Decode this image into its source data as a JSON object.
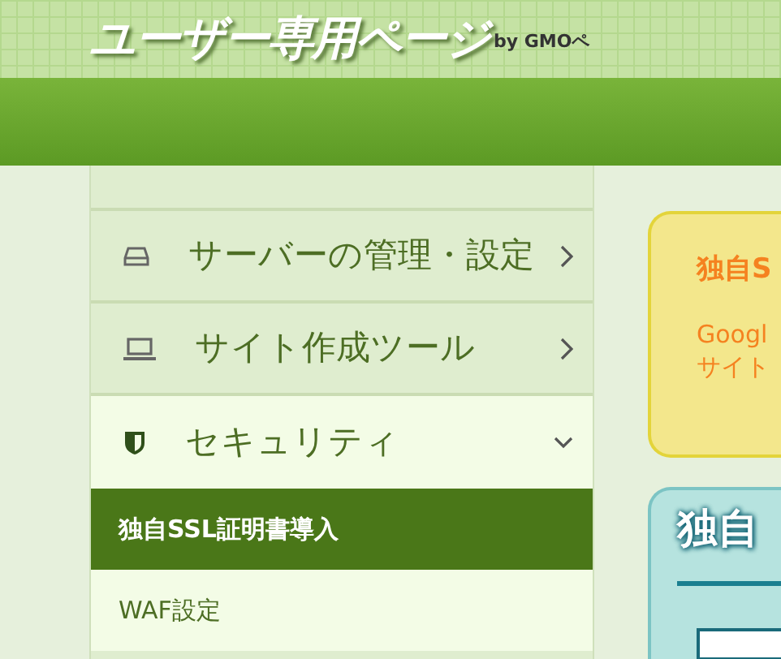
{
  "header": {
    "logo": "ユーザー専用ページ",
    "byline": "by GMOペ"
  },
  "sidebar": {
    "items": [
      {
        "label": "サーバーの管理・設定",
        "expanded": false
      },
      {
        "label": "サイト作成ツール",
        "expanded": false
      },
      {
        "label": "セキュリティ",
        "expanded": true,
        "children": [
          {
            "label": "独自SSL証明書導入",
            "selected": true
          },
          {
            "label": "WAF設定",
            "selected": false
          }
        ]
      }
    ]
  },
  "notice": {
    "title": "独自S",
    "lines": [
      "Googl",
      "サイト"
    ]
  },
  "panel": {
    "title": "独自"
  }
}
